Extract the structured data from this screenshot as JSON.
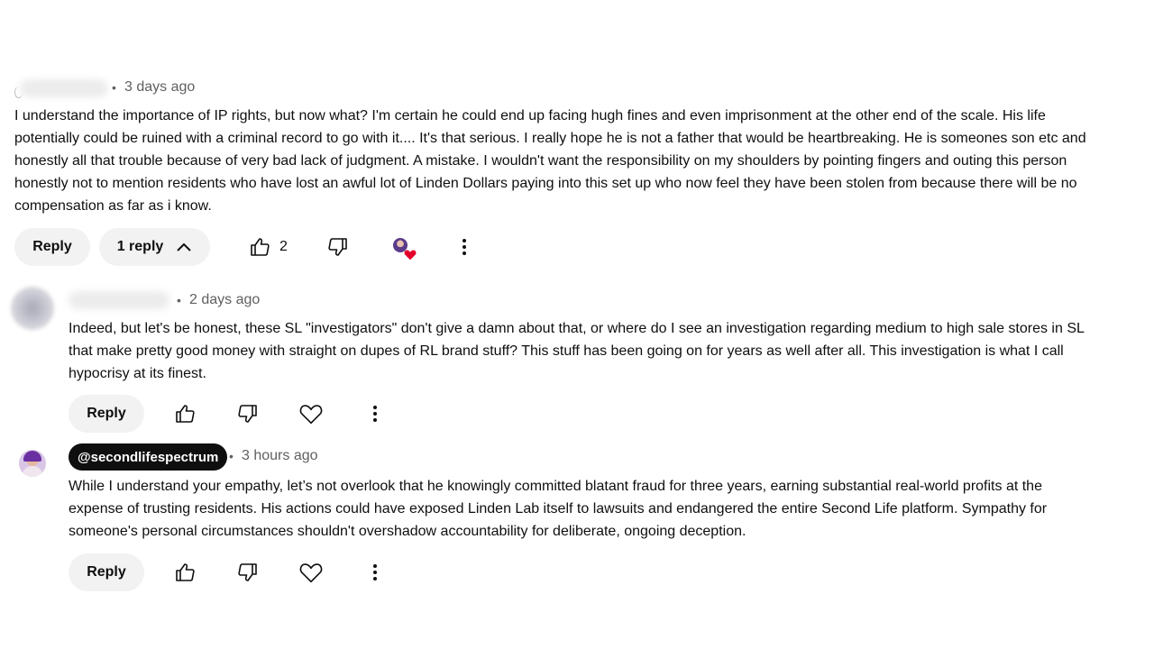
{
  "comments": [
    {
      "time": "3 days ago",
      "text_lines": [
        "I understand the importance of IP rights, but now what? I'm certain he could end up facing hugh fines and even imprisonment at the other end of the scale. His life",
        "potentially could be ruined with a criminal record to go with it.... It's that serious. I really hope he is not a father that would be heartbreaking. He is someones son etc and",
        "honestly all that trouble because of very bad  lack of judgment. A mistake. I wouldn't want the responsibility on my shoulders by pointing fingers and outing this person",
        "honestly not to mention residents who have lost an awful lot of Linden Dollars paying into this set up who now feel they have been stolen from because there will be no",
        "compensation as far as i know."
      ],
      "reply_label": "Reply",
      "replies_toggle_label": "1 reply",
      "like_count": "2"
    },
    {
      "time": "2 days ago",
      "text_lines": [
        "Indeed, but let's be honest, these SL \"investigators\" don't give a damn about that, or where do I see an investigation regarding medium to high sale stores in SL",
        "that make pretty good money with straight on dupes of RL brand stuff? This stuff has been going on for years as well after all. This investigation is what I call",
        "hypocrisy at its finest."
      ],
      "reply_label": "Reply"
    },
    {
      "handle": "@secondlifespectrum",
      "time": "3 hours ago",
      "text_lines": [
        "While I understand your empathy, let’s not overlook that he knowingly committed blatant fraud for three years, earning substantial real-world profits at the",
        "expense of trusting residents. His actions could have exposed Linden Lab itself to lawsuits and endangered the entire Second Life platform. Sympathy for",
        "someone's personal circumstances shouldn't overshadow accountability for deliberate, ongoing deception."
      ],
      "reply_label": "Reply"
    }
  ],
  "separator": "•",
  "icons": [
    "like-icon",
    "dislike-icon",
    "heart-icon",
    "more-vert-icon",
    "chevron-up-icon",
    "creator-heart-badge"
  ],
  "colors": {
    "accent_heart": "#e3002b",
    "pill_bg": "#f2f2f2",
    "handle_bg": "#0f0f0f",
    "meta": "#606060"
  }
}
